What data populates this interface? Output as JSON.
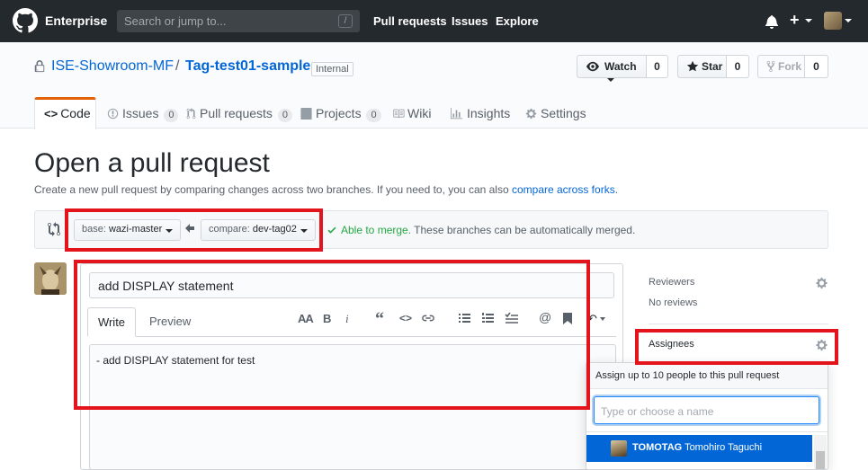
{
  "header": {
    "brand": "Enterprise",
    "search_placeholder": "Search or jump to...",
    "search_key": "/",
    "nav": [
      "Pull requests",
      "Issues",
      "Explore"
    ]
  },
  "repo": {
    "owner": "ISE-Showroom-MF",
    "separator": "/",
    "name": "Tag-test01-sample",
    "visibility": "Internal",
    "watch_label": "Watch",
    "watch_count": "0",
    "star_label": "Star",
    "star_count": "0",
    "fork_label": "Fork",
    "fork_count": "0",
    "tabs": {
      "code": "Code",
      "issues": "Issues",
      "issues_count": "0",
      "pulls": "Pull requests",
      "pulls_count": "0",
      "projects": "Projects",
      "projects_count": "0",
      "wiki": "Wiki",
      "insights": "Insights",
      "settings": "Settings"
    }
  },
  "page": {
    "title": "Open a pull request",
    "description": "Create a new pull request by comparing changes across two branches. If you need to, you can also ",
    "description_link": "compare across forks",
    "description_end": "."
  },
  "range": {
    "base_prefix": "base:",
    "base_branch": "wazi-master",
    "compare_prefix": "compare:",
    "compare_branch": "dev-tag02",
    "merge_ok": "Able to merge.",
    "merge_text": " These branches can be automatically merged."
  },
  "form": {
    "title_value": "add DISPLAY statement",
    "tab_write": "Write",
    "tab_preview": "Preview",
    "toolbar": [
      "AA",
      "B",
      "i"
    ],
    "body_value": "- add DISPLAY statement for test"
  },
  "sidebar": {
    "reviewers_label": "Reviewers",
    "reviewers_value": "No reviews",
    "assignees_label": "Assignees"
  },
  "assignee_popup": {
    "header": "Assign up to 10 people to this pull request",
    "filter_placeholder": "Type or choose a name",
    "items": [
      {
        "login": "TOMOTAG",
        "name": "Tomohiro Taguchi"
      }
    ]
  },
  "colors": {
    "header_bg": "#24292e",
    "link": "#0366d6",
    "success": "#28a745",
    "highlight": "#e3141c",
    "selected_bg": "#0366d6"
  }
}
